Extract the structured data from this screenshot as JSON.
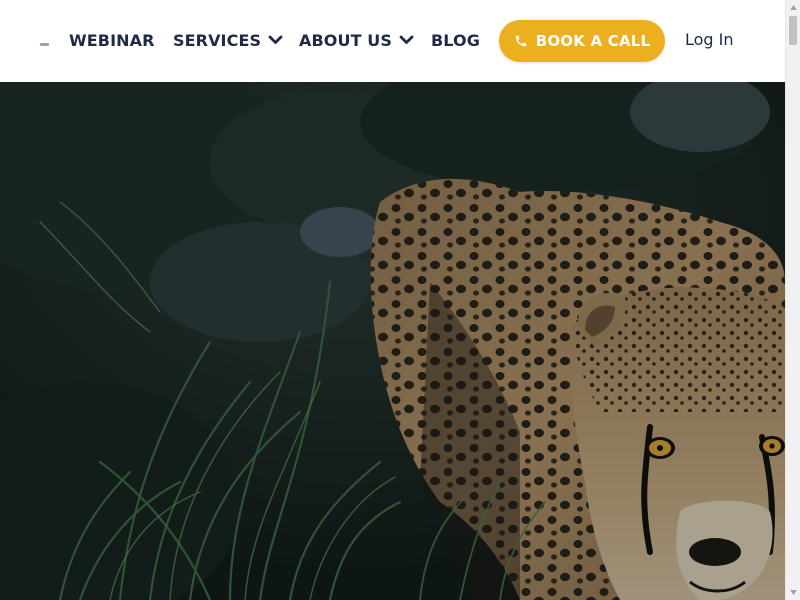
{
  "header": {
    "nav": {
      "webinar": "WEBINAR",
      "services": "SERVICES",
      "about": "ABOUT US",
      "blog": "BLOG"
    },
    "cta_label": "BOOK A CALL",
    "cta_icon": "phone-icon",
    "login_label": "Log In"
  },
  "colors": {
    "nav_text": "#1f2a44",
    "cta_background": "#ecb01f",
    "cta_text": "#ffffff"
  },
  "hero": {
    "image": "cheetah crouching in tall grass, dark overlay"
  }
}
